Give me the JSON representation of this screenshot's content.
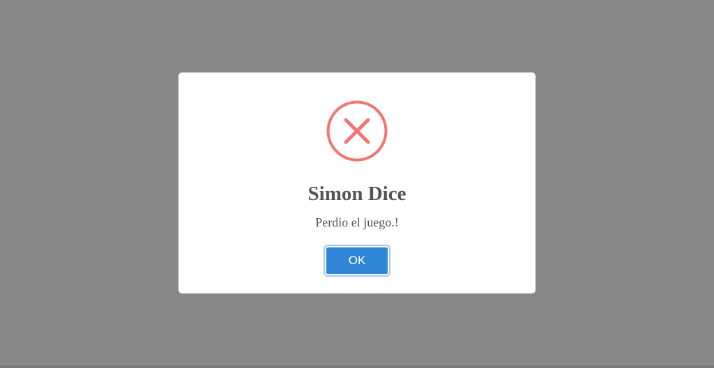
{
  "board": {
    "colors": {
      "top_left": "#52868a",
      "top_right": "#721f89",
      "bottom_left": "#888888",
      "bottom_right": "#888888"
    }
  },
  "modal": {
    "icon": "error-x-icon",
    "icon_color": "#f27474",
    "title": "Simon Dice",
    "message": "Perdio el juego.!",
    "ok_label": "OK",
    "ok_color": "#3085d6"
  },
  "overlay_color": "#888888"
}
